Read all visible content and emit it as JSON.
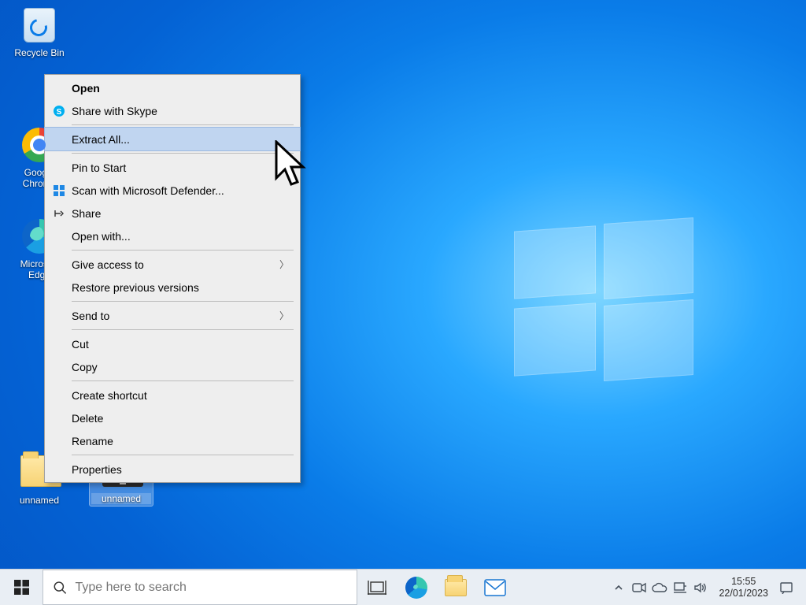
{
  "desktop_icons": {
    "recycle": "Recycle Bin",
    "chrome": "Google Chrome",
    "edge": "Microsoft Edge",
    "folder": "unnamed",
    "zip": "unnamed"
  },
  "context_menu": {
    "open": "Open",
    "share_skype": "Share with Skype",
    "extract_all": "Extract All...",
    "pin_start": "Pin to Start",
    "scan_defender": "Scan with Microsoft Defender...",
    "share": "Share",
    "open_with": "Open with...",
    "give_access": "Give access to",
    "restore_prev": "Restore previous versions",
    "send_to": "Send to",
    "cut": "Cut",
    "copy": "Copy",
    "create_shortcut": "Create shortcut",
    "delete": "Delete",
    "rename": "Rename",
    "properties": "Properties"
  },
  "taskbar": {
    "search_placeholder": "Type here to search",
    "time": "15:55",
    "date": "22/01/2023"
  }
}
